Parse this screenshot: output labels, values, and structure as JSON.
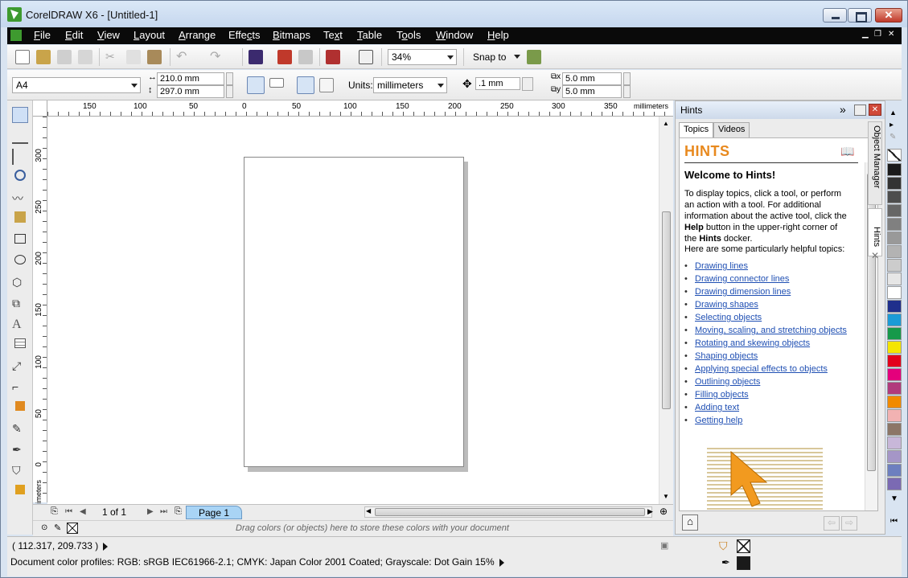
{
  "window": {
    "title": "CorelDRAW X6 - [Untitled-1]"
  },
  "menu": {
    "items": [
      {
        "label": "File",
        "key": "F",
        "rest": "ile"
      },
      {
        "label": "Edit",
        "key": "E",
        "rest": "dit"
      },
      {
        "label": "View",
        "key": "V",
        "rest": "iew"
      },
      {
        "label": "Layout",
        "key": "L",
        "rest": "ayout"
      },
      {
        "label": "Arrange",
        "key": "A",
        "rest": "rrange"
      },
      {
        "label": "Effects",
        "pre": "Effe",
        "key": "c",
        "rest": "ts"
      },
      {
        "label": "Bitmaps",
        "key": "B",
        "rest": "itmaps"
      },
      {
        "label": "Text",
        "pre": "Te",
        "key": "x",
        "rest": "t"
      },
      {
        "label": "Table",
        "key": "T",
        "rest": "able"
      },
      {
        "label": "Tools",
        "pre": "T",
        "key": "o",
        "rest": "ols"
      },
      {
        "label": "Window",
        "key": "W",
        "rest": "indow"
      },
      {
        "label": "Help",
        "key": "H",
        "rest": "elp"
      }
    ]
  },
  "toolbar": {
    "zoom": "34%",
    "snap_to": "Snap to"
  },
  "property_bar": {
    "page_size": "A4",
    "width": "210.0 mm",
    "height": "297.0 mm",
    "units_label": "Units:",
    "units": "millimeters",
    "nudge": ".1 mm",
    "dup_x": "5.0 mm",
    "dup_y": "5.0 mm"
  },
  "rulers": {
    "top_labels": [
      "150",
      "100",
      "50",
      "0",
      "50",
      "100",
      "150",
      "200",
      "250",
      "300",
      "350"
    ],
    "top_unit": "millimeters",
    "left_labels": [
      "300",
      "250",
      "200",
      "150",
      "100",
      "50",
      "0"
    ],
    "left_unit": "millimeters"
  },
  "navigator": {
    "page_count": "1 of 1",
    "page_tab": "Page 1"
  },
  "doc_palette": {
    "hint": "Drag colors (or objects) here to store these colors with your document"
  },
  "hints": {
    "panel_title": "Hints",
    "tabs": [
      "Topics",
      "Videos"
    ],
    "heading": "HINTS",
    "welcome": "Welcome to Hints!",
    "intro_parts": [
      "To display topics, click a tool, or perform an action with a tool. For additional information about the active tool, click the ",
      "Help",
      " button in the upper-right corner of the ",
      "Hints",
      " docker."
    ],
    "helpful": "Here are some particularly helpful topics:",
    "topics": [
      "Drawing lines",
      "Drawing connector lines",
      "Drawing dimension lines",
      "Drawing shapes",
      "Selecting objects",
      "Moving, scaling, and stretching objects",
      "Rotating and skewing objects",
      "Shaping objects",
      "Applying special effects to objects",
      "Outlining objects",
      "Filling objects",
      "Adding text",
      "Getting help"
    ]
  },
  "side_tabs": {
    "object_manager": "Object Manager",
    "hints": "Hints"
  },
  "palette": {
    "colors": [
      "#1a1a1a",
      "#333333",
      "#4d4d4d",
      "#666666",
      "#808080",
      "#999999",
      "#b3b3b3",
      "#cccccc",
      "#e6e6e6",
      "#ffffff",
      "#1f2f8c",
      "#1b9bd7",
      "#17994a",
      "#f4e500",
      "#e3001b",
      "#e4007c",
      "#b13a7c",
      "#f18a00",
      "#f2b2b2",
      "#8c7667",
      "#c8b7d9",
      "#a596c7",
      "#6d7fbf",
      "#7b6ab3"
    ]
  },
  "status": {
    "coords": "( 112.317, 209.733 )",
    "profiles": "Document color profiles: RGB: sRGB IEC61966-2.1; CMYK: Japan Color 2001 Coated; Grayscale: Dot Gain 15%"
  }
}
